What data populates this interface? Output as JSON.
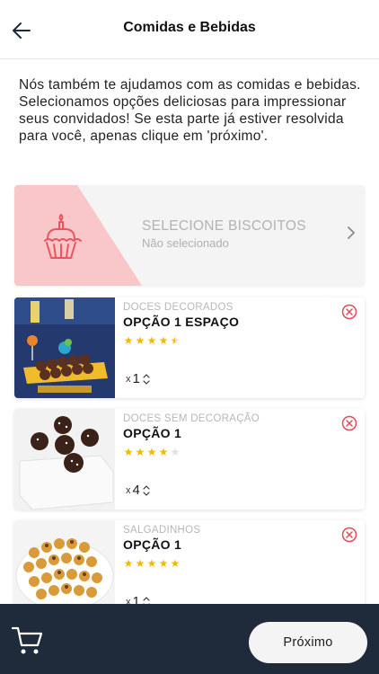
{
  "header": {
    "title": "Comidas e Bebidas",
    "back_icon": "arrow-left-icon"
  },
  "intro": "Nós também te ajudamos com as comidas e bebidas. Selecionamos opções deliciosas para impressionar seus convidados! Se esta parte já estiver resolvida para você, apenas clique em 'próximo'.",
  "biscuit_selector": {
    "title": "SELECIONE BISCOITOS",
    "status": "Não selecionado",
    "icon": "cupcake-icon",
    "accent_color": "#f9c6c9",
    "icon_color": "#e8575f"
  },
  "items": [
    {
      "category": "DOCES DECORADOS",
      "name": "OPÇÃO 1 ESPAÇO",
      "rating": 4.5,
      "max_rating": 5,
      "qty_prefix": "x",
      "quantity": "1"
    },
    {
      "category": "DOCES SEM DECORAÇÃO",
      "name": "OPÇÃO 1",
      "rating": 4,
      "max_rating": 5,
      "qty_prefix": "x",
      "quantity": "4"
    },
    {
      "category": "SALGADINHOS",
      "name": "OPÇÃO 1",
      "rating": 5,
      "max_rating": 5,
      "qty_prefix": "x",
      "quantity": "1"
    }
  ],
  "footer": {
    "next_label": "Próximo",
    "cart_icon": "shopping-cart-icon",
    "background": "#1f2a3a"
  },
  "colors": {
    "star": "#f5b800",
    "star_empty": "#e0e0e0",
    "remove": "#e04b55"
  }
}
